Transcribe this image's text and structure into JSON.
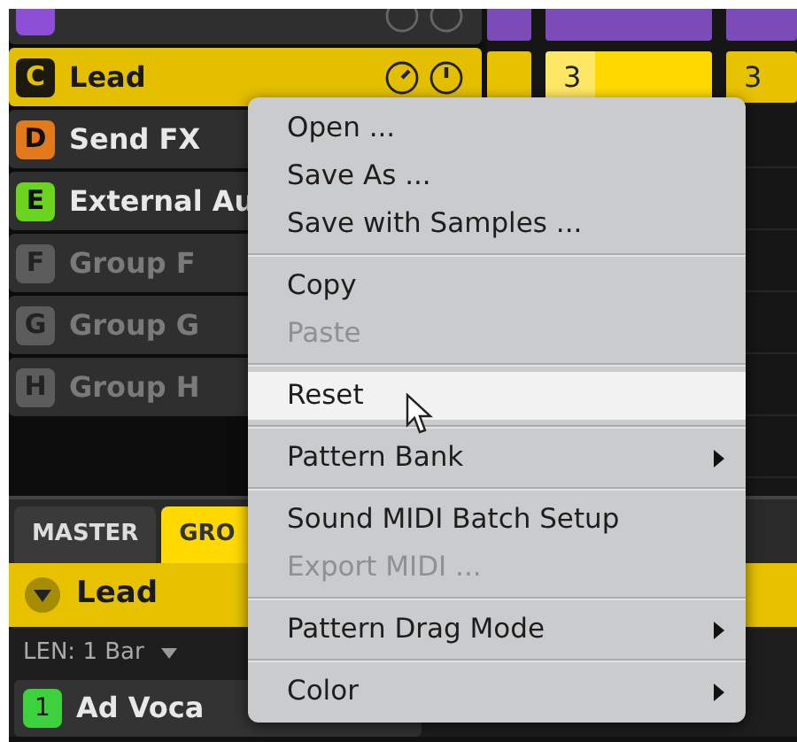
{
  "groups": [
    {
      "color": "#8c4fd6",
      "selected": false,
      "empty": false,
      "knobs": true
    },
    {
      "letter": "C",
      "name": "Lead",
      "color": "#1c1a0c",
      "selected": true,
      "empty": false,
      "knobs": true
    },
    {
      "letter": "D",
      "name": "Send FX",
      "color": "#e27a1c",
      "selected": false,
      "empty": false
    },
    {
      "letter": "E",
      "name": "External Au",
      "color": "#6ad41e",
      "selected": false,
      "empty": false
    },
    {
      "letter": "F",
      "name": "Group F",
      "color": "#5c5c5c",
      "selected": false,
      "empty": true
    },
    {
      "letter": "G",
      "name": "Group G",
      "color": "#5c5c5c",
      "selected": false,
      "empty": true
    },
    {
      "letter": "H",
      "name": "Group H",
      "color": "#5c5c5c",
      "selected": false,
      "empty": true
    }
  ],
  "pattern_rows": [
    {
      "color": "#7b4bb8",
      "cells": [
        {
          "selected": false
        },
        {
          "selected": false
        },
        {
          "selected": false
        }
      ]
    },
    {
      "color": "#e6c200",
      "cells": [
        {
          "selected": false
        },
        {
          "label": "3",
          "selected": true
        },
        {
          "label": "3",
          "selected": false
        }
      ]
    }
  ],
  "tabs": [
    {
      "label": "MASTER",
      "selected": false
    },
    {
      "label": "GRO",
      "selected": true
    }
  ],
  "sound_group": {
    "name": "Lead",
    "expanded": true
  },
  "length": "LEN: 1 Bar",
  "sounds": [
    {
      "number": "1",
      "name": "Ad Voca",
      "color": "#3ed13e"
    }
  ],
  "menu": {
    "sections": [
      [
        {
          "label": "Open ...",
          "disabled": false,
          "selected": false,
          "submenu": false
        },
        {
          "label": "Save As ...",
          "disabled": false,
          "selected": false,
          "submenu": false
        },
        {
          "label": "Save with Samples ...",
          "disabled": false,
          "selected": false,
          "submenu": false
        }
      ],
      [
        {
          "label": "Copy",
          "disabled": false,
          "selected": false,
          "submenu": false
        },
        {
          "label": "Paste",
          "disabled": true,
          "selected": false,
          "submenu": false
        }
      ],
      [
        {
          "label": "Reset",
          "disabled": false,
          "selected": true,
          "submenu": false
        }
      ],
      [
        {
          "label": "Pattern Bank",
          "disabled": false,
          "selected": false,
          "submenu": true
        }
      ],
      [
        {
          "label": "Sound MIDI Batch Setup",
          "disabled": false,
          "selected": false,
          "submenu": false
        },
        {
          "label": "Export MIDI ...",
          "disabled": true,
          "selected": false,
          "submenu": false
        }
      ],
      [
        {
          "label": "Pattern Drag Mode",
          "disabled": false,
          "selected": false,
          "submenu": true
        }
      ],
      [
        {
          "label": "Color",
          "disabled": false,
          "selected": false,
          "submenu": true
        }
      ]
    ]
  }
}
